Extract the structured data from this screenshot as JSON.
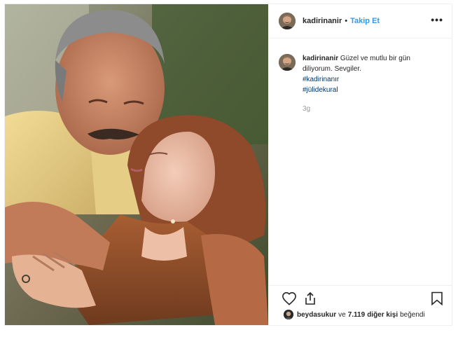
{
  "post": {
    "username": "kadirinanir",
    "separator": "•",
    "follow_label": "Takip Et",
    "more_icon": "more-options-icon",
    "more_label": "•••",
    "caption": {
      "username": "kadirinanir",
      "text": "Güzel ve mutlu bir gün diliyorum. Sevgiler.",
      "hashtags": [
        "#kadirinanır",
        "#jülidekural"
      ],
      "time_ago": "3g"
    },
    "actions": {
      "like_icon": "heart-icon",
      "share_icon": "share-icon",
      "save_icon": "bookmark-icon"
    },
    "likes": {
      "liker": "beydasukur",
      "conj": "ve",
      "count": "7.119",
      "rest": "diğer kişi",
      "suffix": "beğendi"
    },
    "colors": {
      "link_blue": "#3897f0",
      "hashtag": "#003569",
      "muted": "#999999"
    }
  }
}
